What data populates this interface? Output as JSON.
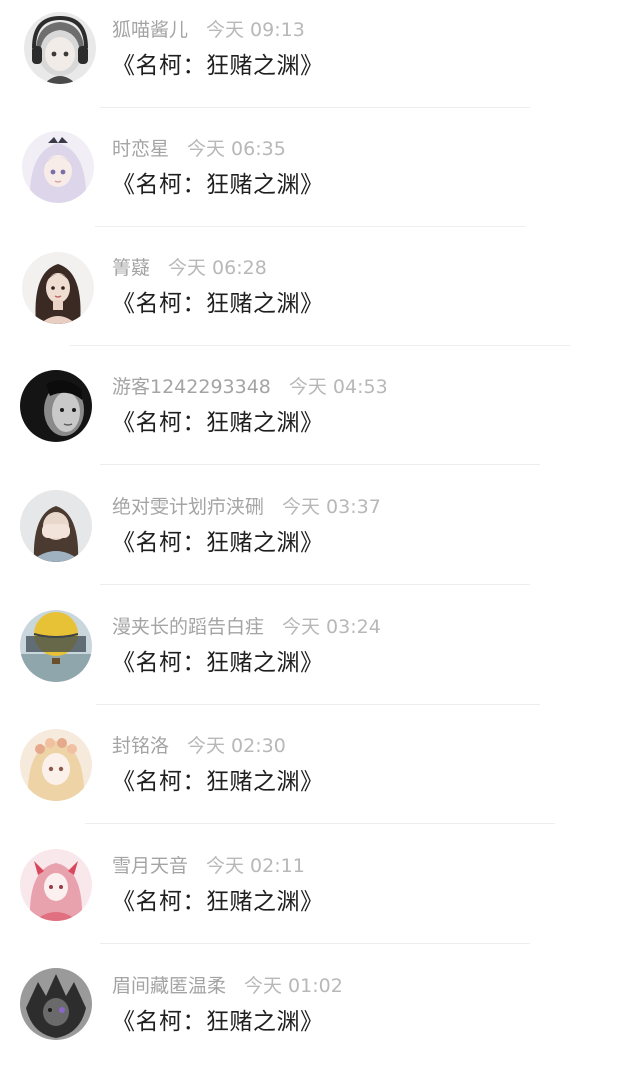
{
  "comments": [
    {
      "user": "狐喵酱儿",
      "time": "今天 09:13",
      "content": "《名柯：狂赌之渊》",
      "avatar": "girl-headphones-avatar"
    },
    {
      "user": "时恋星",
      "time": "今天 06:35",
      "content": "《名柯：狂赌之渊》",
      "avatar": "anime-girl-white-hair-avatar"
    },
    {
      "user": "箐薿",
      "time": "今天 06:28",
      "content": "《名柯：狂赌之渊》",
      "avatar": "woman-portrait-avatar"
    },
    {
      "user": "游客1242293348",
      "time": "今天 04:53",
      "content": "《名柯：狂赌之渊》",
      "avatar": "dark-face-avatar"
    },
    {
      "user": "绝对雯计划疖浃硎",
      "time": "今天 03:37",
      "content": "《名柯：狂赌之渊》",
      "avatar": "girl-covering-face-avatar"
    },
    {
      "user": "漫夹长的蹈告白疰",
      "time": "今天 03:24",
      "content": "《名柯：狂赌之渊》",
      "avatar": "hot-air-balloon-avatar"
    },
    {
      "user": "封铭洛",
      "time": "今天 02:30",
      "content": "《名柯：狂赌之渊》",
      "avatar": "anime-girl-flower-crown-avatar"
    },
    {
      "user": "雪月天音",
      "time": "今天 02:11",
      "content": "《名柯：狂赌之渊》",
      "avatar": "anime-girl-pink-avatar"
    },
    {
      "user": "眉间藏匿温柔",
      "time": "今天 01:02",
      "content": "《名柯：狂赌之渊》",
      "avatar": "dark-anime-character-avatar"
    }
  ]
}
